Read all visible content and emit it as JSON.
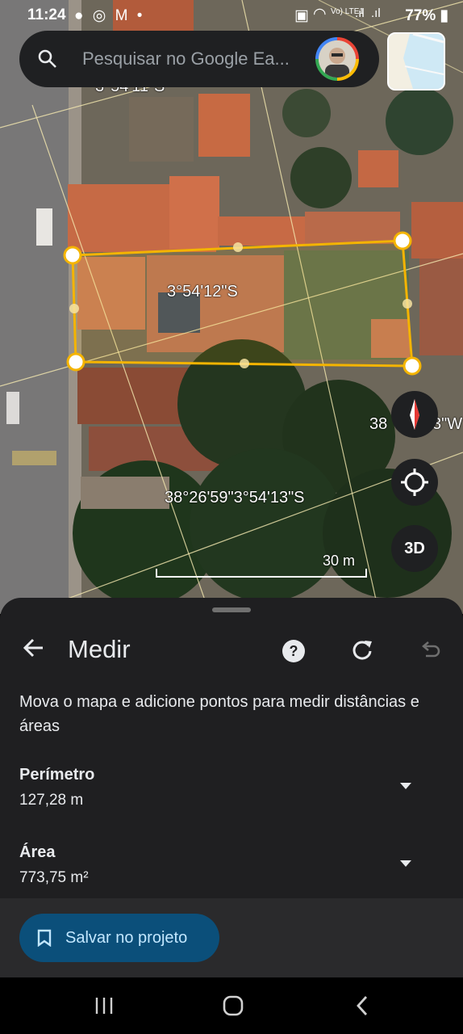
{
  "status_bar": {
    "time": "11:24",
    "left_icons": "● ◎ M •",
    "network": "Vo) LTE1",
    "battery": "77%"
  },
  "search": {
    "placeholder": "Pesquisar no Google Ea..."
  },
  "map": {
    "coordinates": {
      "top_partial": "3°54'11\"S",
      "center": "3°54'12\"S",
      "right_partial": "38",
      "right_partial_2": "3\"W",
      "bottom": "38°26'59\"3°54'13\"S"
    },
    "scale_label": "30 m",
    "button_3d": "3D"
  },
  "panel": {
    "title": "Medir",
    "instructions": "Mova o mapa e adicione pontos para medir distâncias e áreas",
    "perimeter": {
      "label": "Perímetro",
      "value": "127,28 m"
    },
    "area": {
      "label": "Área",
      "value": "773,75 m²"
    },
    "save_label": "Salvar no projeto"
  },
  "colors": {
    "measure_line": "#f4b400",
    "panel_background": "#1f1f21",
    "save_button": "#0b4f7a"
  }
}
